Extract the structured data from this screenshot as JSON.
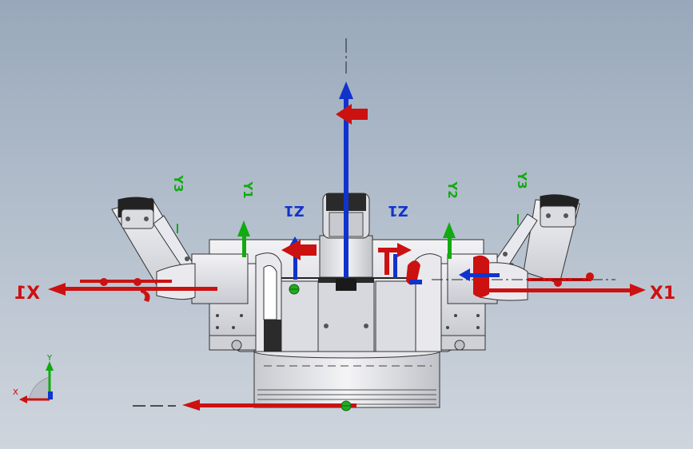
{
  "view": {
    "background_top": "#98a8ba",
    "background_bottom": "#cfd5dd",
    "part_fill": "#e6e6ea",
    "part_stroke": "#3a3a3a"
  },
  "colors": {
    "x_axis": "#cc1111",
    "y_axis": "#11aa11",
    "z_axis": "#1133cc"
  },
  "axis_labels": {
    "x1_right": "X1",
    "x1_left": "X1",
    "y1": "Y1",
    "y2": "Y2",
    "y3_left": "Y3",
    "y3_right": "Y3",
    "z1_left": "Z1",
    "z1_right": "Z1"
  },
  "triad": {
    "x_label": "X",
    "y_label": "Y"
  }
}
